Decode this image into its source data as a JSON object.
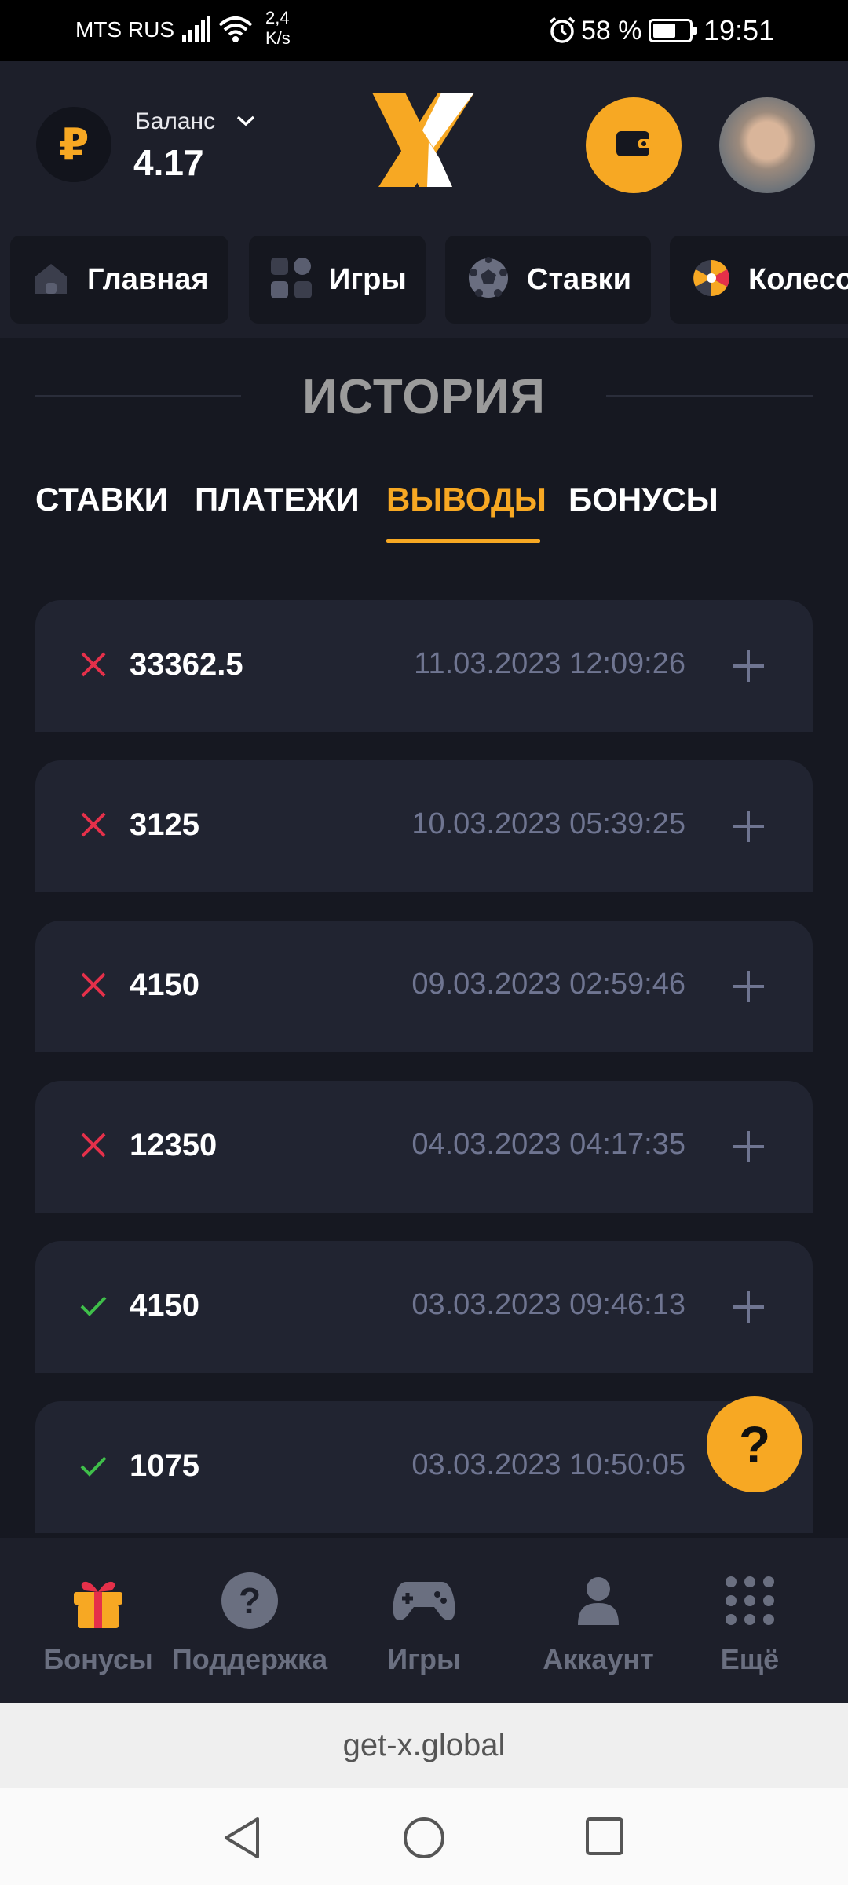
{
  "status_bar": {
    "carrier": "MTS RUS",
    "speed_value": "2,4",
    "speed_unit": "K/s",
    "battery": "58 %",
    "time": "19:51"
  },
  "header": {
    "currency_symbol": "₽",
    "balance_label": "Баланс",
    "balance_value": "4.17"
  },
  "nav_tabs": [
    {
      "label": "Главная",
      "icon": "home-icon"
    },
    {
      "label": "Игры",
      "icon": "games-grid-icon"
    },
    {
      "label": "Ставки",
      "icon": "soccer-ball-icon"
    },
    {
      "label": "Колесо",
      "icon": "wheel-icon"
    }
  ],
  "page_title": "ИСТОРИЯ",
  "history_tabs": {
    "bets": "СТАВКИ",
    "payments": "ПЛАТЕЖИ",
    "withdrawals": "ВЫВОДЫ",
    "bonuses": "БОНУСЫ",
    "active": "withdrawals"
  },
  "withdrawals": [
    {
      "status": "rejected",
      "amount": "33362.5",
      "datetime": "11.03.2023 12:09:26"
    },
    {
      "status": "rejected",
      "amount": "3125",
      "datetime": "10.03.2023 05:39:25"
    },
    {
      "status": "rejected",
      "amount": "4150",
      "datetime": "09.03.2023 02:59:46"
    },
    {
      "status": "rejected",
      "amount": "12350",
      "datetime": "04.03.2023 04:17:35"
    },
    {
      "status": "approved",
      "amount": "4150",
      "datetime": "03.03.2023 09:46:13"
    },
    {
      "status": "approved",
      "amount": "1075",
      "datetime": "03.03.2023 10:50:05"
    }
  ],
  "help_fab": "?",
  "bottom_nav": [
    {
      "label": "Бонусы",
      "icon": "gift-icon"
    },
    {
      "label": "Поддержка",
      "icon": "question-circle-icon"
    },
    {
      "label": "Игры",
      "icon": "gamepad-icon"
    },
    {
      "label": "Аккаунт",
      "icon": "user-icon"
    },
    {
      "label": "Ещё",
      "icon": "dots-grid-icon"
    }
  ],
  "browser": {
    "url": "get-x.global"
  },
  "colors": {
    "accent": "#f7a823",
    "background": "#161821",
    "card": "#212431",
    "rejected": "#e5304a",
    "approved": "#3fbf4a",
    "muted_text": "#6f7591"
  }
}
